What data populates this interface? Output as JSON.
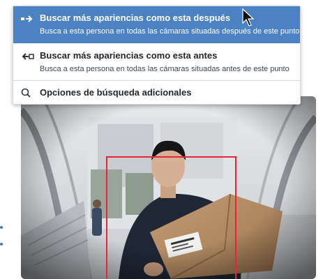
{
  "menu": {
    "items": [
      {
        "icon": "arrow-right-icon",
        "title": "Buscar más apariencias como esta después",
        "subtitle": "Busca a esta persona en todas las cámaras situadas después de este punto",
        "selected": true
      },
      {
        "icon": "arrow-left-icon",
        "title": "Buscar más apariencias como esta antes",
        "subtitle": "Busca a esta persona en todas las cámaras situadas antes de este punto",
        "selected": false
      },
      {
        "icon": "search-icon",
        "title": "Opciones de búsqueda adicionales",
        "selected": false
      }
    ]
  },
  "colors": {
    "selected_background": "#4b82c3",
    "detection_box": "#e5263a",
    "menu_text": "#23272b"
  },
  "camera": {
    "package_label_icon": "barcode-label-icon"
  }
}
